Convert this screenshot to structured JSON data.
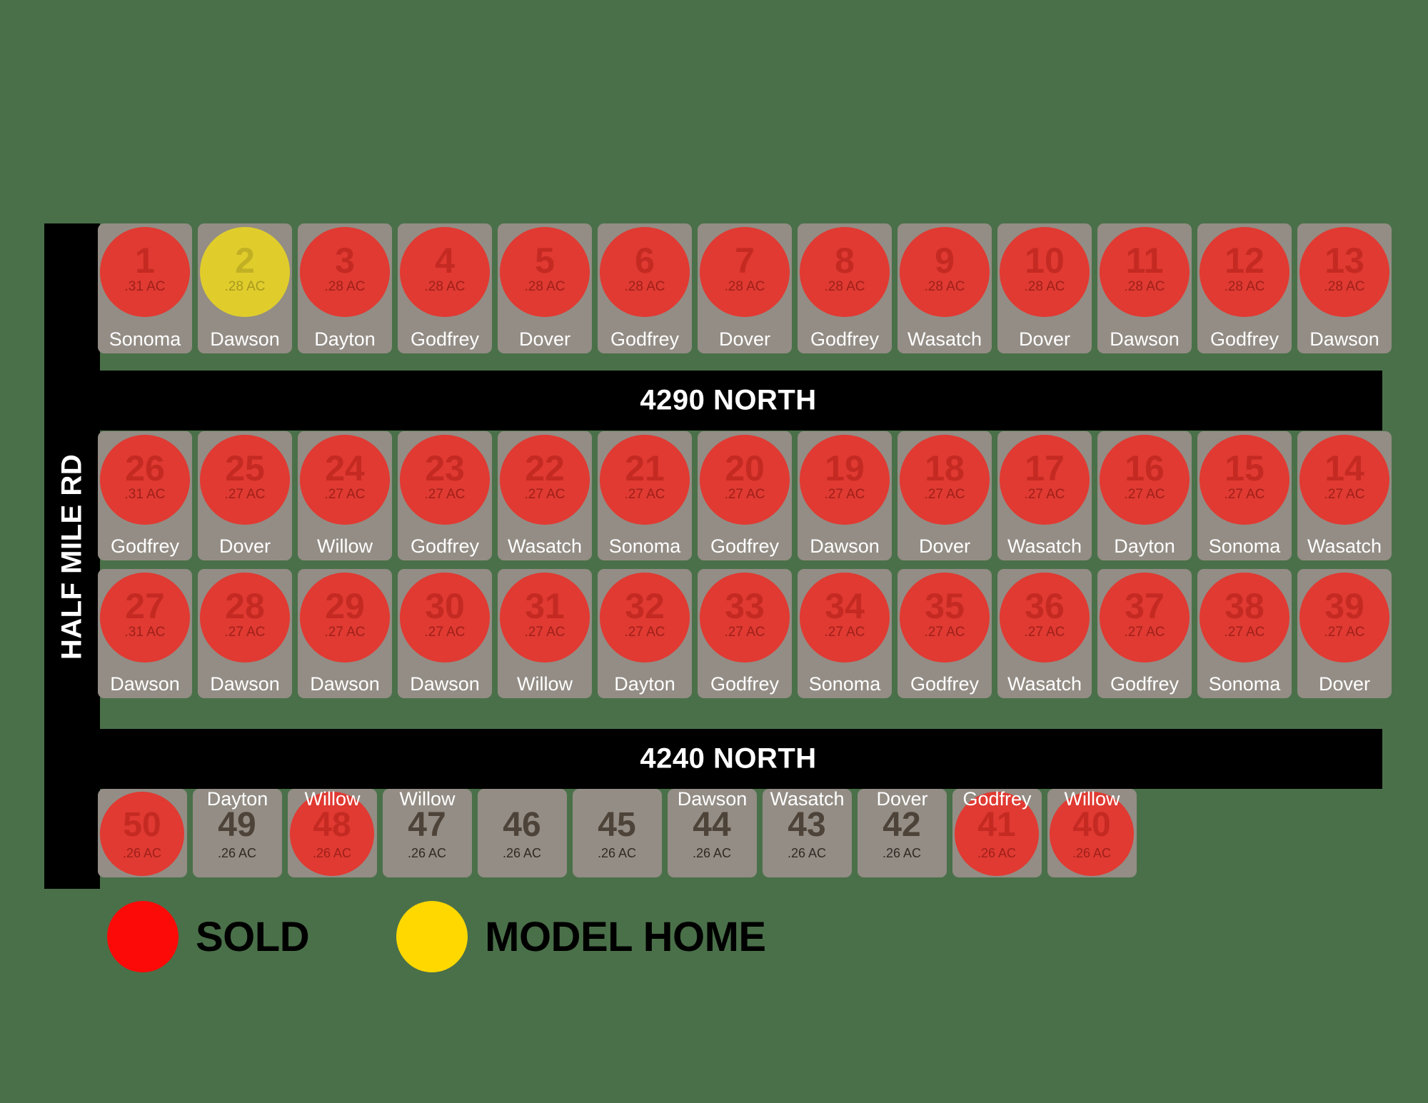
{
  "roads": {
    "vertical_label": "HALF MILE RD",
    "street_4290": "4290 NORTH",
    "street_4240": "4240 NORTH"
  },
  "legend": {
    "sold_label": "SOLD",
    "model_label": "MODEL HOME",
    "sold_color": "#fb0a08",
    "model_color": "#ffd800"
  },
  "colors": {
    "background": "#4a7049",
    "lot_tile": "#938d85",
    "sold_circle": "#e03a32",
    "model_circle": "#e0cd2c",
    "road": "#000000"
  },
  "rows": {
    "top": [
      {
        "lot": "1",
        "acres": ".31 AC",
        "plan": "Sonoma",
        "status": "sold"
      },
      {
        "lot": "2",
        "acres": ".28 AC",
        "plan": "Dawson",
        "status": "model"
      },
      {
        "lot": "3",
        "acres": ".28 AC",
        "plan": "Dayton",
        "status": "sold"
      },
      {
        "lot": "4",
        "acres": ".28 AC",
        "plan": "Godfrey",
        "status": "sold"
      },
      {
        "lot": "5",
        "acres": ".28 AC",
        "plan": "Dover",
        "status": "sold"
      },
      {
        "lot": "6",
        "acres": ".28 AC",
        "plan": "Godfrey",
        "status": "sold"
      },
      {
        "lot": "7",
        "acres": ".28 AC",
        "plan": "Dover",
        "status": "sold"
      },
      {
        "lot": "8",
        "acres": ".28 AC",
        "plan": "Godfrey",
        "status": "sold"
      },
      {
        "lot": "9",
        "acres": ".28 AC",
        "plan": "Wasatch",
        "status": "sold"
      },
      {
        "lot": "10",
        "acres": ".28 AC",
        "plan": "Dover",
        "status": "sold"
      },
      {
        "lot": "11",
        "acres": ".28 AC",
        "plan": "Dawson",
        "status": "sold"
      },
      {
        "lot": "12",
        "acres": ".28 AC",
        "plan": "Godfrey",
        "status": "sold"
      },
      {
        "lot": "13",
        "acres": ".28 AC",
        "plan": "Dawson",
        "status": "sold"
      }
    ],
    "mid1": [
      {
        "lot": "26",
        "acres": ".31 AC",
        "plan": "Godfrey",
        "status": "sold"
      },
      {
        "lot": "25",
        "acres": ".27 AC",
        "plan": "Dover",
        "status": "sold"
      },
      {
        "lot": "24",
        "acres": ".27 AC",
        "plan": "Willow",
        "status": "sold"
      },
      {
        "lot": "23",
        "acres": ".27 AC",
        "plan": "Godfrey",
        "status": "sold"
      },
      {
        "lot": "22",
        "acres": ".27 AC",
        "plan": "Wasatch",
        "status": "sold"
      },
      {
        "lot": "21",
        "acres": ".27 AC",
        "plan": "Sonoma",
        "status": "sold"
      },
      {
        "lot": "20",
        "acres": ".27 AC",
        "plan": "Godfrey",
        "status": "sold"
      },
      {
        "lot": "19",
        "acres": ".27 AC",
        "plan": "Dawson",
        "status": "sold"
      },
      {
        "lot": "18",
        "acres": ".27 AC",
        "plan": "Dover",
        "status": "sold"
      },
      {
        "lot": "17",
        "acres": ".27 AC",
        "plan": "Wasatch",
        "status": "sold"
      },
      {
        "lot": "16",
        "acres": ".27 AC",
        "plan": "Dayton",
        "status": "sold"
      },
      {
        "lot": "15",
        "acres": ".27 AC",
        "plan": "Sonoma",
        "status": "sold"
      },
      {
        "lot": "14",
        "acres": ".27 AC",
        "plan": "Wasatch",
        "status": "sold"
      }
    ],
    "mid2": [
      {
        "lot": "27",
        "acres": ".31 AC",
        "plan": "Dawson",
        "status": "sold"
      },
      {
        "lot": "28",
        "acres": ".27 AC",
        "plan": "Dawson",
        "status": "sold"
      },
      {
        "lot": "29",
        "acres": ".27 AC",
        "plan": "Dawson",
        "status": "sold"
      },
      {
        "lot": "30",
        "acres": ".27 AC",
        "plan": "Dawson",
        "status": "sold"
      },
      {
        "lot": "31",
        "acres": ".27 AC",
        "plan": "Willow",
        "status": "sold"
      },
      {
        "lot": "32",
        "acres": ".27 AC",
        "plan": "Dayton",
        "status": "sold"
      },
      {
        "lot": "33",
        "acres": ".27 AC",
        "plan": "Godfrey",
        "status": "sold"
      },
      {
        "lot": "34",
        "acres": ".27 AC",
        "plan": "Sonoma",
        "status": "sold"
      },
      {
        "lot": "35",
        "acres": ".27 AC",
        "plan": "Godfrey",
        "status": "sold"
      },
      {
        "lot": "36",
        "acres": ".27 AC",
        "plan": "Wasatch",
        "status": "sold"
      },
      {
        "lot": "37",
        "acres": ".27 AC",
        "plan": "Godfrey",
        "status": "sold"
      },
      {
        "lot": "38",
        "acres": ".27 AC",
        "plan": "Sonoma",
        "status": "sold"
      },
      {
        "lot": "39",
        "acres": ".27 AC",
        "plan": "Dover",
        "status": "sold"
      }
    ],
    "bottom": [
      {
        "lot": "50",
        "acres": ".26 AC",
        "plan": "",
        "status": "sold"
      },
      {
        "lot": "49",
        "acres": ".26 AC",
        "plan": "Dayton",
        "status": "open"
      },
      {
        "lot": "48",
        "acres": ".26 AC",
        "plan": "Willow",
        "status": "sold"
      },
      {
        "lot": "47",
        "acres": ".26 AC",
        "plan": "Willow",
        "status": "open"
      },
      {
        "lot": "46",
        "acres": ".26 AC",
        "plan": "",
        "status": "open"
      },
      {
        "lot": "45",
        "acres": ".26 AC",
        "plan": "",
        "status": "open"
      },
      {
        "lot": "44",
        "acres": ".26 AC",
        "plan": "Dawson",
        "status": "open"
      },
      {
        "lot": "43",
        "acres": ".26 AC",
        "plan": "Wasatch",
        "status": "open"
      },
      {
        "lot": "42",
        "acres": ".26 AC",
        "plan": "Dover",
        "status": "open"
      },
      {
        "lot": "41",
        "acres": ".26 AC",
        "plan": "Godfrey",
        "status": "sold"
      },
      {
        "lot": "40",
        "acres": ".26 AC",
        "plan": "Willow",
        "status": "sold"
      }
    ]
  }
}
